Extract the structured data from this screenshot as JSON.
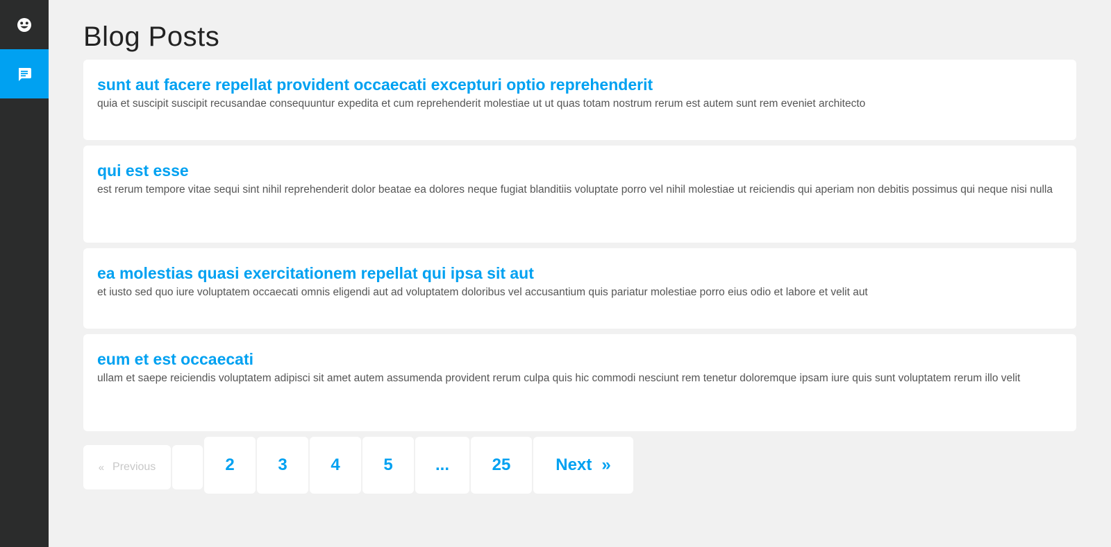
{
  "sidebar": {
    "items": [
      {
        "icon": "smiley-icon",
        "active": false
      },
      {
        "icon": "message-icon",
        "active": true
      }
    ]
  },
  "page": {
    "title": "Blog Posts"
  },
  "posts": [
    {
      "title": "sunt aut facere repellat provident occaecati excepturi optio reprehenderit",
      "body": "quia et suscipit suscipit recusandae consequuntur expedita et cum reprehenderit molestiae ut ut quas totam nostrum rerum est autem sunt rem eveniet architecto"
    },
    {
      "title": "qui est esse",
      "body": "est rerum tempore vitae sequi sint nihil reprehenderit dolor beatae ea dolores neque fugiat blanditiis voluptate porro vel nihil molestiae ut reiciendis qui aperiam non debitis possimus qui neque nisi nulla"
    },
    {
      "title": "ea molestias quasi exercitationem repellat qui ipsa sit aut",
      "body": "et iusto sed quo iure voluptatem occaecati omnis eligendi aut ad voluptatem doloribus vel accusantium quis pariatur molestiae porro eius odio et labore et velit aut"
    },
    {
      "title": "eum et est occaecati",
      "body": "ullam et saepe reiciendis voluptatem adipisci sit amet autem assumenda provident rerum culpa quis hic commodi nesciunt rem tenetur doloremque ipsam iure quis sunt voluptatem rerum illo velit"
    }
  ],
  "pagination": {
    "prev_arrow": "«",
    "prev_label": "Previous",
    "current_page": "",
    "pages": [
      "2",
      "3",
      "4",
      "5"
    ],
    "ellipsis": "...",
    "last_page": "25",
    "next_label": "Next",
    "next_arrow": "»"
  },
  "colors": {
    "accent": "#00a1f1",
    "sidebar": "#2b2c2c",
    "background": "#f1f1f1"
  }
}
